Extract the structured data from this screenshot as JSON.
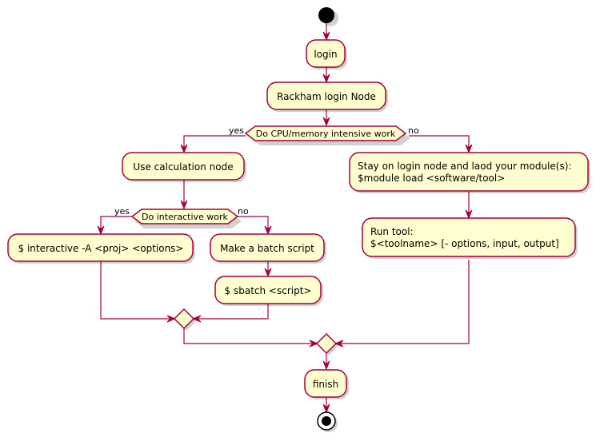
{
  "diagram": {
    "type": "activity",
    "colors": {
      "node_fill": "#FEFECE",
      "line": "#A80036",
      "start": "#000000"
    },
    "start": "start",
    "end": "stop",
    "nodes": {
      "login": "login",
      "rackham": "Rackham login Node",
      "decision1": "Do CPU/memory intensive work",
      "calc": "Use calculation node",
      "decision2": "Do interactive work",
      "interactive": "$ interactive -A <proj> <options>",
      "batch": "Make a batch script",
      "sbatch": "$ sbatch <script>",
      "stay_line1": "Stay on login node and laod your module(s):",
      "stay_line2": "$module load <software/tool>",
      "run_line1": "Run tool:",
      "run_line2": "$<toolname> [- options, input, output]",
      "finish": "finish"
    },
    "guards": {
      "d1_yes": "yes",
      "d1_no": "no",
      "d2_yes": "yes",
      "d2_no": "no"
    }
  }
}
